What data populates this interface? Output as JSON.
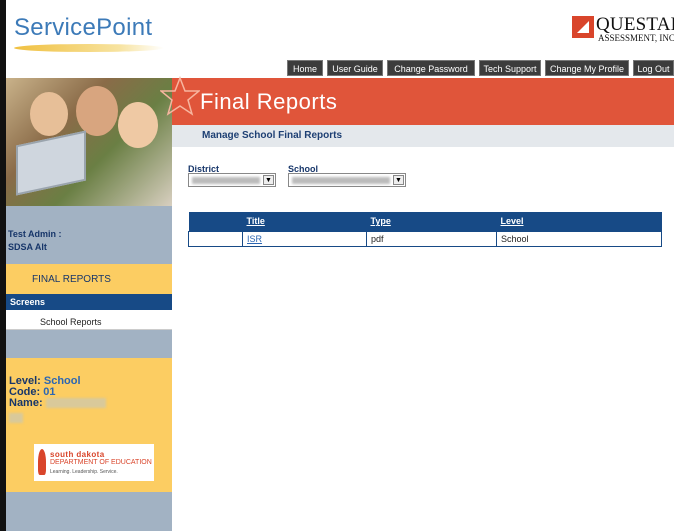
{
  "header": {
    "app_name": "ServicePoint",
    "vendor_name": "QUESTAR",
    "vendor_sub": "ASSESSMENT, INC."
  },
  "nav": {
    "items": [
      {
        "label": "Home"
      },
      {
        "label": "User Guide"
      },
      {
        "label": "Change Password"
      },
      {
        "label": "Tech Support"
      },
      {
        "label": "Change My Profile"
      },
      {
        "label": "Log Out"
      }
    ]
  },
  "page": {
    "title": "Final Reports",
    "subtitle": "Manage School Final Reports"
  },
  "sidebar": {
    "user_line1": "Test Admin :",
    "user_line2": "SDSA Alt",
    "section": "FINAL REPORTS",
    "screens_label": "Screens",
    "screen_item": "School Reports",
    "level_label": "Level:",
    "level_value": "School",
    "code_label": "Code:",
    "code_value": "01",
    "name_label": "Name:"
  },
  "doe_logo": {
    "line1": "south dakota",
    "line2": "DEPARTMENT OF EDUCATION",
    "line3": "Learning. Leadership. Service."
  },
  "filters": {
    "district_label": "District",
    "school_label": "School"
  },
  "table": {
    "headers": [
      "Title",
      "Type",
      "Level"
    ],
    "rows": [
      {
        "title": "ISR",
        "type": "pdf",
        "level": "School"
      }
    ]
  },
  "colors": {
    "banner": "#e0553a",
    "nav_bg": "#3c3c3c",
    "sidebar_navy": "#174a86",
    "sidebar_yellow": "#fccd62",
    "sidebar_grey": "#a2b2c3"
  }
}
